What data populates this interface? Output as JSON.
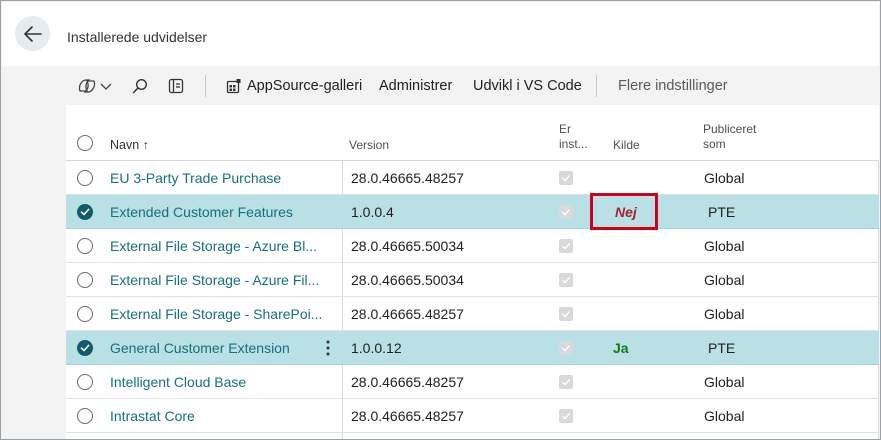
{
  "header": {
    "title": "Installerede udvidelser"
  },
  "actions": {
    "appsource": "AppSource-galleri",
    "administrer": "Administrer",
    "udvikl": "Udvikl i VS Code",
    "flere": "Flere indstillinger"
  },
  "columns": {
    "navn": "Navn",
    "sort_arrow": "↑",
    "version": "Version",
    "er_installeret_1": "Er",
    "er_installeret_2": "inst...",
    "kilde": "Kilde",
    "publiceret_1": "Publiceret",
    "publiceret_2": "som"
  },
  "rows": [
    {
      "name": "EU 3-Party Trade Purchase",
      "version": "28.0.46665.48257",
      "installed": true,
      "source": "",
      "published": "Global",
      "selected": false
    },
    {
      "name": "Extended Customer Features",
      "version": "1.0.0.4",
      "installed": true,
      "source": "Nej",
      "published": "PTE",
      "selected": true
    },
    {
      "name": "External File Storage - Azure Bl...",
      "version": "28.0.46665.50034",
      "installed": true,
      "source": "",
      "published": "Global",
      "selected": false
    },
    {
      "name": "External File Storage - Azure Fil...",
      "version": "28.0.46665.50034",
      "installed": true,
      "source": "",
      "published": "Global",
      "selected": false
    },
    {
      "name": "External File Storage - SharePoi...",
      "version": "28.0.46665.48257",
      "installed": true,
      "source": "",
      "published": "Global",
      "selected": false
    },
    {
      "name": "General Customer Extension",
      "version": "1.0.0.12",
      "installed": true,
      "source": "Ja",
      "published": "PTE",
      "selected": true
    },
    {
      "name": "Intelligent Cloud Base",
      "version": "28.0.46665.48257",
      "installed": true,
      "source": "",
      "published": "Global",
      "selected": false
    },
    {
      "name": "Intrastat Core",
      "version": "28.0.46665.48257",
      "installed": true,
      "source": "",
      "published": "Global",
      "selected": false
    }
  ],
  "colors": {
    "accent": "#147080",
    "selected_row": "#b8e0e5",
    "nej": "#a4262c",
    "ja": "#107c10",
    "highlight": "#d0021b"
  },
  "icons": {
    "back": "arrow-left-icon",
    "copilot": "copilot-icon",
    "search": "search-icon",
    "filter": "filter-pane-icon",
    "appsource": "appsource-icon",
    "kebab": "more-vertical-icon"
  }
}
